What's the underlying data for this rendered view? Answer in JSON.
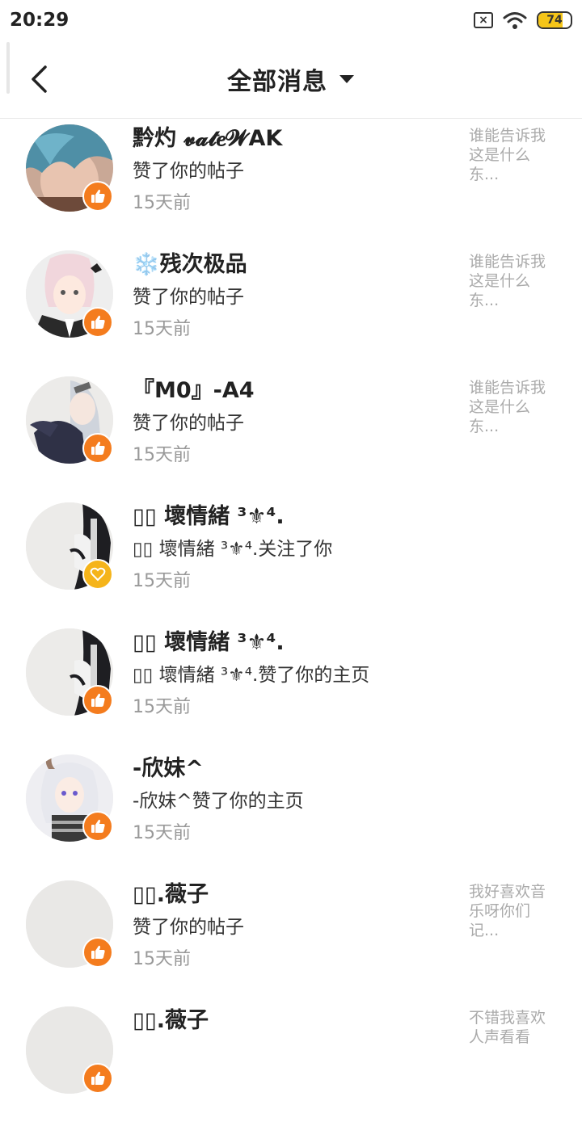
{
  "status_bar": {
    "time": "20:29",
    "battery_level": "74",
    "battery_fraction": 0.74,
    "icons": [
      "sim-off-icon",
      "wifi-icon",
      "battery-icon"
    ]
  },
  "header": {
    "title": "全部消息",
    "icons": [
      "back-arrow-icon",
      "dropdown-caret-icon"
    ]
  },
  "colors": {
    "like_badge": "#f47c1e",
    "follow_badge": "#f5b41a",
    "battery_fill": "#f5c518",
    "muted_text": "#999999",
    "preview_text": "#aaaaaa"
  },
  "notifications": [
    {
      "name": "黔灼 𝓿𝓪𝓽𝒆𝓦AK",
      "action": "赞了你的帖子",
      "time": "15天前",
      "preview": "谁能告诉我这是什么东...",
      "badge": "like",
      "avatar": "blue-hair"
    },
    {
      "name": "❄️残次极品",
      "action": "赞了你的帖子",
      "time": "15天前",
      "preview": "谁能告诉我这是什么东...",
      "badge": "like",
      "avatar": "anime-pink"
    },
    {
      "name": "『M0』-A4",
      "action": "赞了你的帖子",
      "time": "15天前",
      "preview": "谁能告诉我这是什么东...",
      "badge": "like",
      "avatar": "anime-silver"
    },
    {
      "name": "▯▯ 壞情緒 ³⚜⁴.",
      "action": "▯▯ 壞情緒 ³⚜⁴.关注了你",
      "time": "15天前",
      "preview": "",
      "badge": "follow",
      "avatar": "dark-figure"
    },
    {
      "name": "▯▯ 壞情緒 ³⚜⁴.",
      "action": "▯▯ 壞情緒 ³⚜⁴.赞了你的主页",
      "time": "15天前",
      "preview": "",
      "badge": "like",
      "avatar": "dark-figure"
    },
    {
      "name": "-欣妹^",
      "action": "-欣妹^赞了你的主页",
      "time": "15天前",
      "preview": "",
      "badge": "like",
      "avatar": "anime-horns"
    },
    {
      "name": "▯▯.薇子",
      "action": "赞了你的帖子",
      "time": "15天前",
      "preview": "我好喜欢音乐呀你们记...",
      "badge": "like",
      "avatar": "blank"
    },
    {
      "name": "▯▯.薇子",
      "action": "",
      "time": "",
      "preview": "不错我喜欢人声看看",
      "badge": "like",
      "avatar": "blank"
    }
  ]
}
